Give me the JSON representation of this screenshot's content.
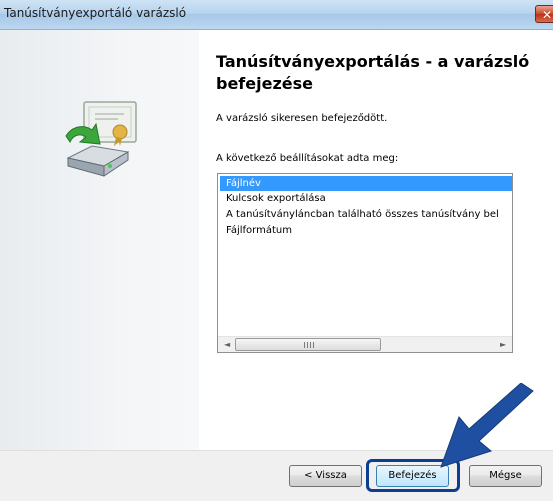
{
  "window": {
    "title": "Tanúsítványexportáló varázsló",
    "close_glyph": "✕"
  },
  "wizard": {
    "heading": "Tanúsítványexportálás - a varázsló befejezése",
    "message": "A varázsló sikeresen befejeződött.",
    "settings_label": "A következő beállításokat adta meg:",
    "settings": [
      {
        "label": "Fájlnév",
        "selected": true
      },
      {
        "label": "Kulcsok exportálása",
        "selected": false
      },
      {
        "label": "A tanúsítványláncban található összes tanúsítvány bel",
        "selected": false
      },
      {
        "label": "Fájlformátum",
        "selected": false
      }
    ],
    "scroll_left_glyph": "◄",
    "scroll_right_glyph": "►",
    "icon": "certificate-export-icon"
  },
  "buttons": {
    "back": "< Vissza",
    "finish": "Befejezés",
    "cancel": "Mégse"
  },
  "annotation": {
    "arrow_icon": "pointer-arrow-icon",
    "highlight_color": "#0b3d91"
  }
}
